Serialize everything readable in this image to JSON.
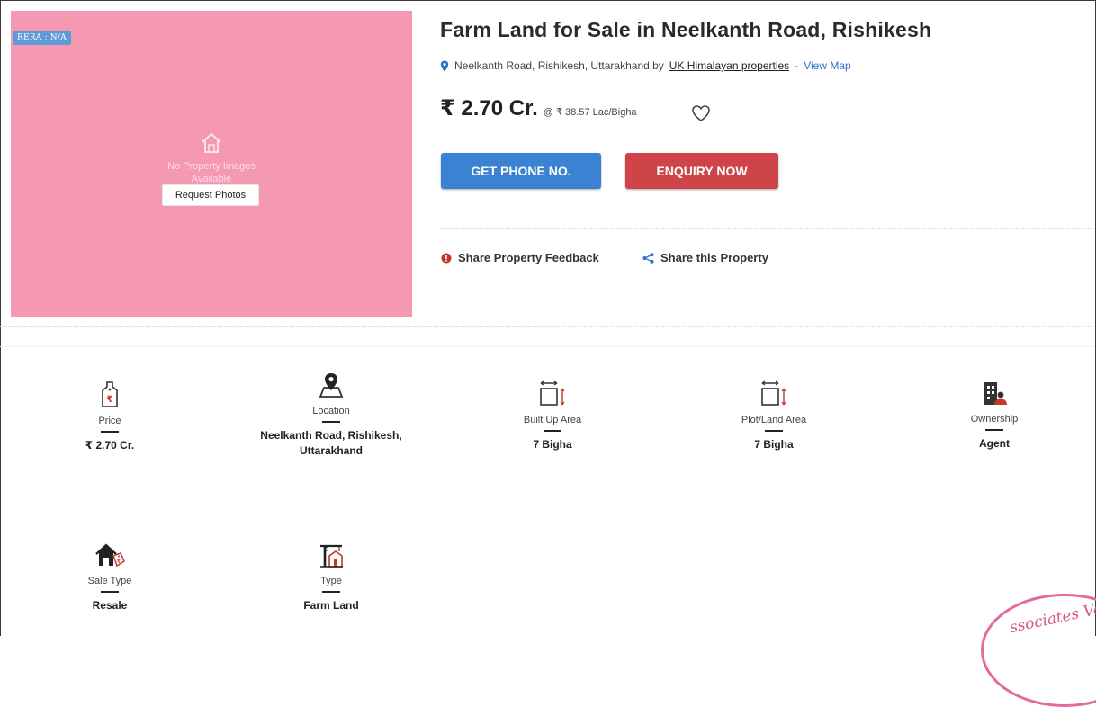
{
  "listing": {
    "rera_badge": "RERA : N/A",
    "no_images_text_1": "No Property Images",
    "no_images_text_2": "Available",
    "request_photos_label": "Request Photos",
    "title": "Farm Land for Sale in Neelkanth Road, Rishikesh",
    "address": "Neelkanth Road, Rishikesh, Uttarakhand by",
    "agent_link": "UK Himalayan properties",
    "separator": "-",
    "view_map_label": "View Map",
    "price_main": "₹ 2.70 Cr.",
    "price_per_unit": "@ ₹ 38.57 Lac/Bigha",
    "get_phone_label": "GET PHONE NO.",
    "enquiry_label": "ENQUIRY NOW",
    "share_feedback_label": "Share Property Feedback",
    "share_property_label": "Share this Property"
  },
  "stats": [
    {
      "label": "Price",
      "value": "₹ 2.70 Cr.",
      "icon": "price-tag-icon"
    },
    {
      "label": "Location",
      "value": "Neelkanth Road, Rishikesh, Uttarakhand",
      "icon": "location-pin-icon"
    },
    {
      "label": "Built Up Area",
      "value": "7 Bigha",
      "icon": "area-icon"
    },
    {
      "label": "Plot/Land Area",
      "value": "7 Bigha",
      "icon": "area-icon"
    },
    {
      "label": "Ownership",
      "value": "Agent",
      "icon": "building-agent-icon"
    },
    {
      "label": "Sale Type",
      "value": "Resale",
      "icon": "house-sale-icon"
    },
    {
      "label": "Type",
      "value": "Farm Land",
      "icon": "construction-crane-icon"
    }
  ],
  "stamp_text": "ssociates Val",
  "colors": {
    "photo_bg": "#f598b2",
    "rera_badge": "#5f9bd8",
    "phone_button": "#3b83d2",
    "enquiry_button": "#cf4449",
    "link_blue": "#2f6fc7",
    "stamp": "#e26aa0"
  }
}
